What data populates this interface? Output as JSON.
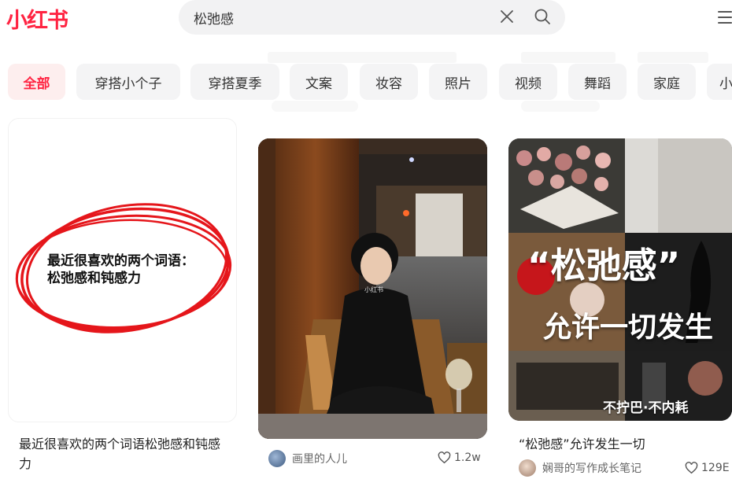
{
  "brand": {
    "logo": "小红书",
    "color": "#ff2442"
  },
  "search": {
    "query": "松弛感",
    "clear_icon": "close-icon",
    "search_icon": "search-icon"
  },
  "menu_icon": "hamburger-menu-icon",
  "tabs": [
    {
      "label": "全部",
      "active": true
    },
    {
      "label": "穿搭小个子"
    },
    {
      "label": "穿搭夏季"
    },
    {
      "label": "文案"
    },
    {
      "label": "妆容"
    },
    {
      "label": "照片"
    },
    {
      "label": "视频"
    },
    {
      "label": "舞蹈"
    },
    {
      "label": "家庭"
    },
    {
      "label": "小"
    }
  ],
  "notes": [
    {
      "cover_text_line1": "最近很喜欢的两个词语：",
      "cover_text_line2": "松弛感和钝感力",
      "title": "最近很喜欢的两个词语松弛感和钝感力"
    },
    {
      "watermark": "小红书",
      "author": "画里的人儿",
      "likes": "1.2w"
    },
    {
      "cover_big_line1": "“松弛感”",
      "cover_big_line2": "允许一切发生",
      "cover_small": "不拧巴·不内耗",
      "title": "“松弛感”允许发生一切",
      "author": "娴哥的写作成长笔记",
      "likes": "129E"
    }
  ]
}
